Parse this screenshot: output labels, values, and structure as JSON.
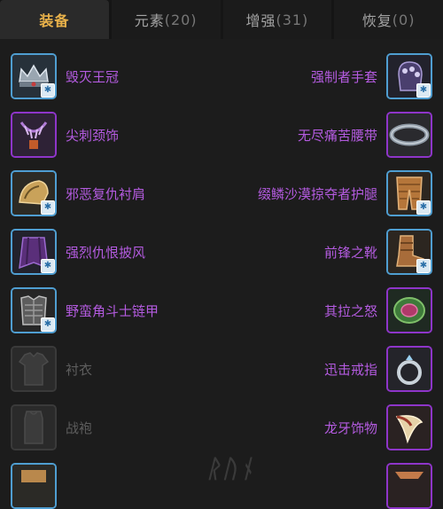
{
  "tabs": [
    {
      "label": "装备",
      "count": ""
    },
    {
      "label": "元素",
      "count": "(20)"
    },
    {
      "label": "增强",
      "count": "(31)"
    },
    {
      "label": "恢复",
      "count": "(0)"
    }
  ],
  "badge_glyph": "✱",
  "left_items": [
    {
      "name": "毁灭王冠",
      "icon": "crown-icon"
    },
    {
      "name": "尖刺颈饰",
      "icon": "necklace-icon"
    },
    {
      "name": "邪恶复仇衬肩",
      "icon": "shoulder-icon"
    },
    {
      "name": "强烈仇恨披风",
      "icon": "cloak-icon"
    },
    {
      "name": "野蛮角斗士链甲",
      "icon": "chest-armor-icon"
    },
    {
      "name": "衬衣",
      "icon": "shirt-icon"
    },
    {
      "name": "战袍",
      "icon": "tabard-icon"
    }
  ],
  "right_items": [
    {
      "name": "强制者手套",
      "icon": "gloves-icon"
    },
    {
      "name": "无尽痛苦腰带",
      "icon": "belt-icon"
    },
    {
      "name": "缀鳞沙漠掠夺者护腿",
      "icon": "legs-icon"
    },
    {
      "name": "前锋之靴",
      "icon": "boots-icon"
    },
    {
      "name": "其拉之怒",
      "icon": "ring-gem-icon"
    },
    {
      "name": "迅击戒指",
      "icon": "ring-icon"
    },
    {
      "name": "龙牙饰物",
      "icon": "fang-trinket-icon"
    }
  ],
  "colors": {
    "epic": "#8e35c9",
    "rare": "#4f9ed1",
    "label_epic": "#b45be0",
    "tab_active": "#e8b14a"
  },
  "watermark": "ᚱᚢᚾ"
}
